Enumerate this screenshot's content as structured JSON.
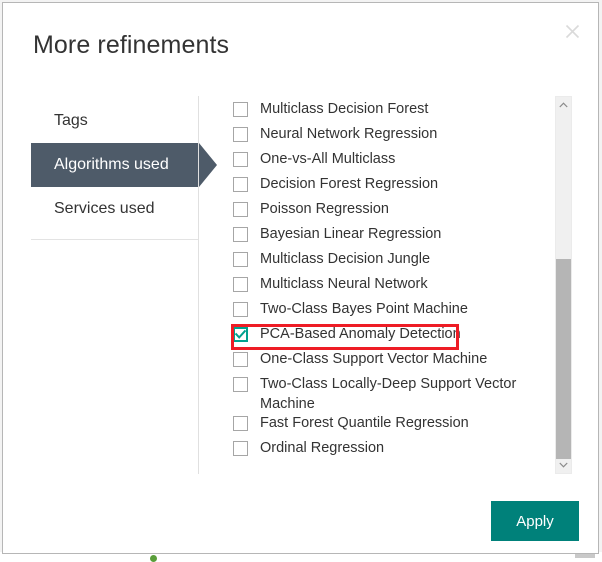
{
  "dialog": {
    "title": "More refinements",
    "close_icon": "close-icon",
    "close_label": "Close"
  },
  "sidebar": {
    "items": [
      {
        "label": "Tags",
        "selected": false
      },
      {
        "label": "Algorithms used",
        "selected": true
      },
      {
        "label": "Services used",
        "selected": false
      }
    ]
  },
  "list": {
    "items": [
      {
        "label": "Multiclass Decision Forest",
        "checked": false
      },
      {
        "label": "Neural Network Regression",
        "checked": false
      },
      {
        "label": "One-vs-All Multiclass",
        "checked": false
      },
      {
        "label": "Decision Forest Regression",
        "checked": false
      },
      {
        "label": "Poisson Regression",
        "checked": false
      },
      {
        "label": "Bayesian Linear Regression",
        "checked": false
      },
      {
        "label": "Multiclass Decision Jungle",
        "checked": false
      },
      {
        "label": "Multiclass Neural Network",
        "checked": false
      },
      {
        "label": "Two-Class Bayes Point Machine",
        "checked": false
      },
      {
        "label": "PCA-Based Anomaly Detection",
        "checked": true
      },
      {
        "label": "One-Class Support Vector Machine",
        "checked": false
      },
      {
        "label": "Two-Class Locally-Deep Support Vector Machine",
        "checked": false
      },
      {
        "label": "Fast Forest Quantile Regression",
        "checked": false
      },
      {
        "label": "Ordinal Regression",
        "checked": false
      }
    ]
  },
  "scrollbar": {
    "up_icon": "chevron-up-icon",
    "down_icon": "chevron-down-icon",
    "thumb": "scrollbar-thumb"
  },
  "footer": {
    "apply_label": "Apply"
  },
  "annotation": {
    "target": "PCA-Based Anomaly Detection",
    "color": "#ee1c25"
  },
  "colors": {
    "accent_teal": "#00817a",
    "checkbox_teal": "#00a18f",
    "nav_selected": "#4e5b69",
    "annotation_red": "#ee1c25"
  }
}
